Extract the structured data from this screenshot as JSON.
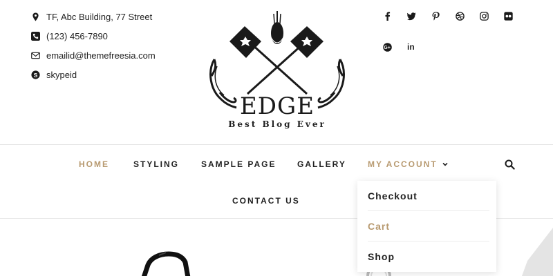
{
  "contact": {
    "address": "TF, Abc Building, 77 Street",
    "phone": "(123) 456-7890",
    "email": "emailid@themefreesia.com",
    "skype": "skypeid",
    "icons": [
      "location-icon",
      "phone-icon",
      "mail-icon",
      "skype-icon"
    ]
  },
  "social": {
    "icons": [
      "facebook-icon",
      "twitter-icon",
      "pinterest-icon",
      "dribbble-icon",
      "instagram-icon",
      "flickr-icon",
      "google-plus-icon",
      "linkedin-icon"
    ],
    "google_label": "G+",
    "linkedin_label": "in"
  },
  "logo": {
    "title": "EDGE",
    "tagline": "Best Blog Ever"
  },
  "nav": {
    "items": [
      {
        "label": "HOME",
        "active": true
      },
      {
        "label": "STYLING"
      },
      {
        "label": "SAMPLE PAGE"
      },
      {
        "label": "GALLERY"
      },
      {
        "label": "MY ACCOUNT"
      },
      {
        "label": "CONTACT US"
      }
    ],
    "accent_color": "#b89a70"
  },
  "dropdown": {
    "items": [
      {
        "label": "Checkout"
      },
      {
        "label": "Cart",
        "highlighted": true
      },
      {
        "label": "Shop"
      }
    ]
  }
}
